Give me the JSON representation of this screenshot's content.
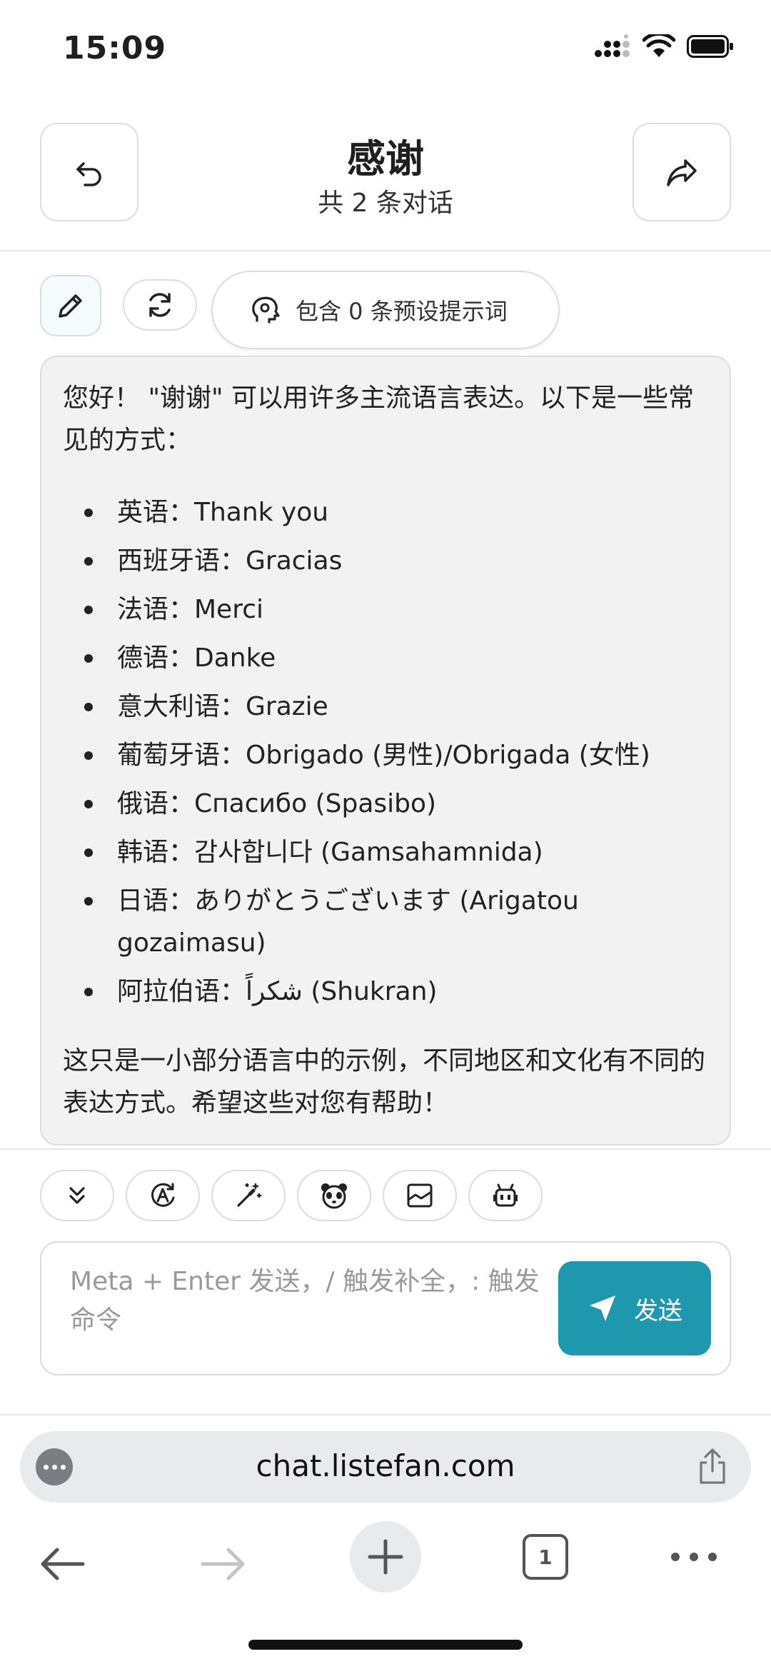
{
  "status_bar": {
    "time": "15:09"
  },
  "header": {
    "title": "感谢",
    "subtitle": "共 2 条对话"
  },
  "toolbar": {
    "prompt_label": "包含 0 条预设提示词"
  },
  "message": {
    "intro": "您好！ \"谢谢\" 可以用许多主流语言表达。以下是一些常见的方式：",
    "items": [
      "英语：Thank you",
      "西班牙语：Gracias",
      "法语：Merci",
      "德语：Danke",
      "意大利语：Grazie",
      "葡萄牙语：Obrigado (男性)/Obrigada (女性)",
      "俄语：Спасибо (Spasibo)",
      "韩语：감사합니다 (Gamsahamnida)",
      "日语：ありがとうございます (Arigatou gozaimasu)",
      "阿拉伯语：شكراً (Shukran)"
    ],
    "outro": "这只是一小部分语言中的示例，不同地区和文化有不同的表达方式。希望这些对您有帮助！"
  },
  "input": {
    "placeholder": "Meta + Enter 发送，/ 触发补全，: 触发命令",
    "send_label": "发送"
  },
  "browser": {
    "url": "chat.listefan.com",
    "tab_count": "1"
  },
  "colors": {
    "accent": "#1f97ad",
    "bubble_bg": "#f2f2f2"
  }
}
